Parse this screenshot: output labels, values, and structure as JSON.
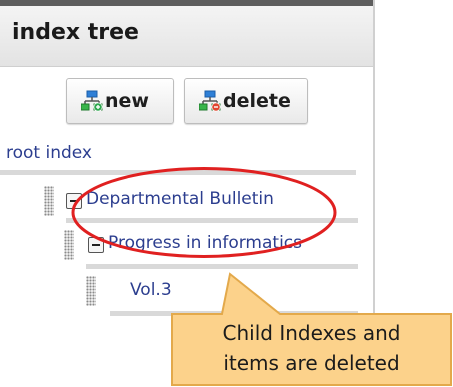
{
  "header": {
    "title": "index tree"
  },
  "toolbar": {
    "new_label": "new",
    "delete_label": "delete"
  },
  "tree": {
    "root_label": "root index",
    "nodes": [
      {
        "label": "Departmental Bulletin",
        "level": 1,
        "toggle": "minus"
      },
      {
        "label": "Progress in informatics",
        "level": 2,
        "toggle": "minus"
      },
      {
        "label": "Vol.3",
        "level": 3
      }
    ]
  },
  "annotation": {
    "line1": "Child Indexes and",
    "line2": "items are deleted",
    "callout_color": "#fcd28b",
    "highlight_color": "#e02020"
  },
  "icons": {
    "new": "tree-add-icon",
    "delete": "tree-delete-icon"
  }
}
